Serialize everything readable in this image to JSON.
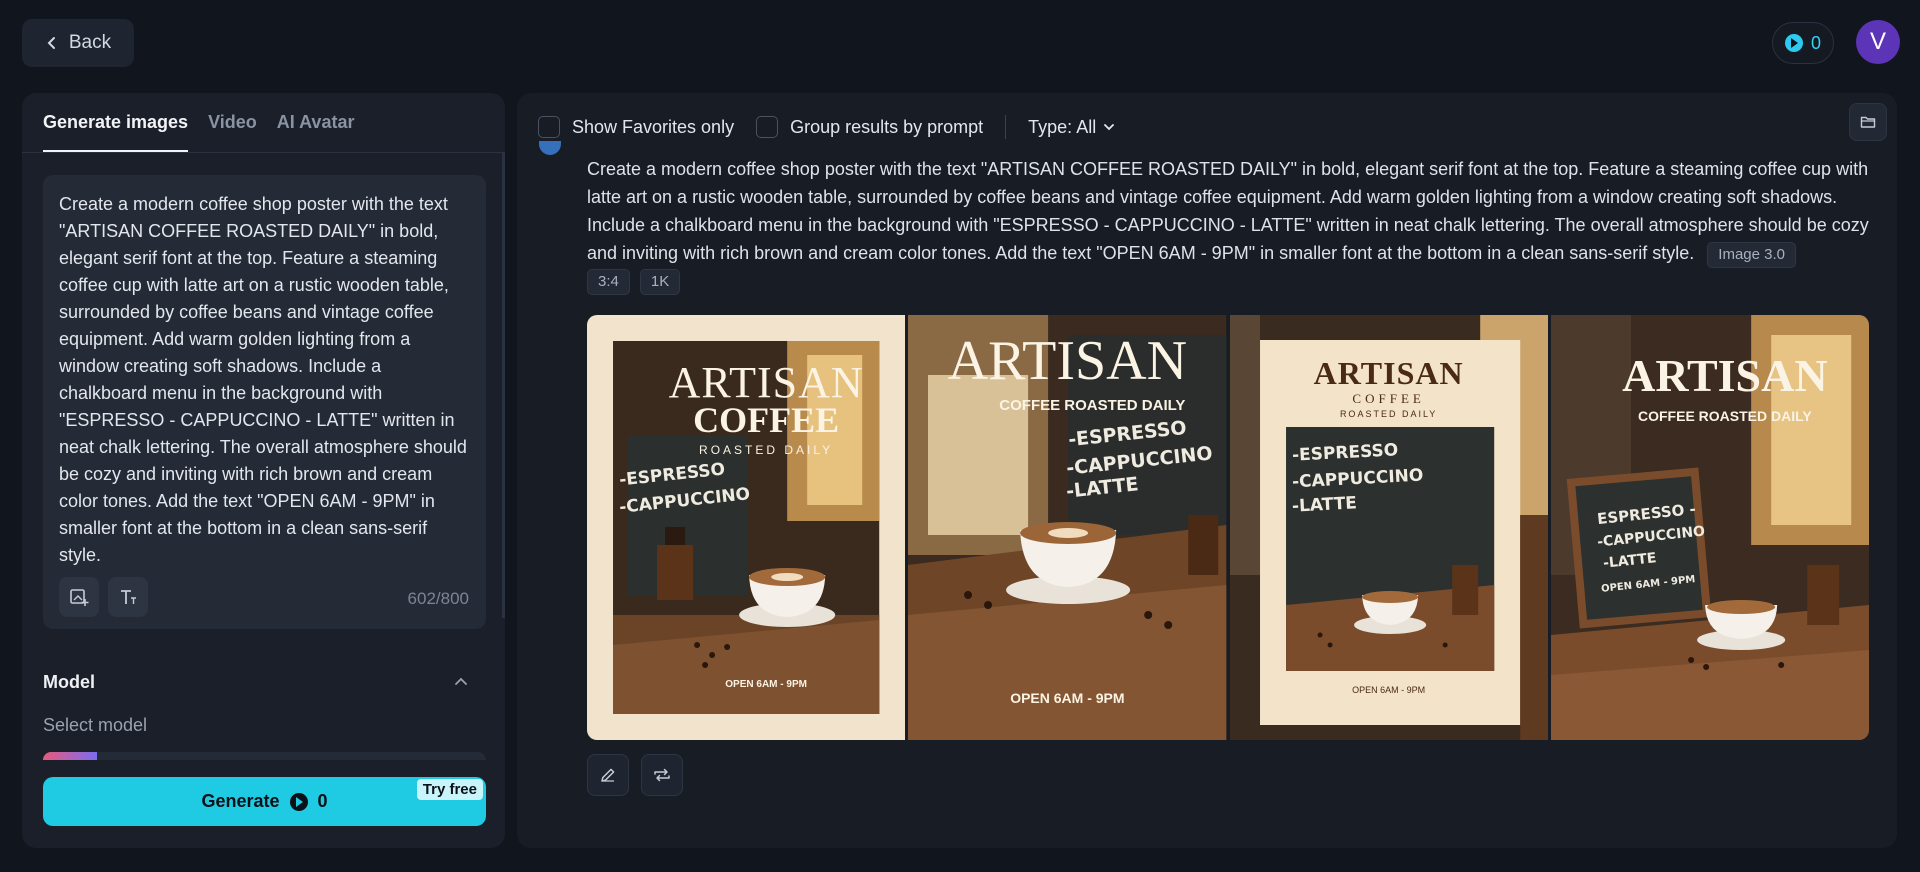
{
  "header": {
    "back_label": "Back",
    "credits": "0",
    "avatar_initial": "V"
  },
  "left_panel": {
    "tabs": [
      {
        "label": "Generate images",
        "active": true
      },
      {
        "label": "Video",
        "active": false
      },
      {
        "label": "AI Avatar",
        "active": false
      }
    ],
    "prompt": "Create a modern coffee shop poster with the text \"ARTISAN COFFEE ROASTED DAILY\" in bold, elegant serif font at the top. Feature a steaming coffee cup with latte art on a rustic wooden table, surrounded by coffee beans and vintage coffee equipment. Add warm golden lighting from a window creating soft shadows. Include a chalkboard menu in the background with \"ESPRESSO - CAPPUCCINO - LATTE\" written in neat chalk lettering. The overall atmosphere should be cozy and inviting with rich brown and cream color tones. Add the text \"OPEN 6AM - 9PM\" in smaller font at the bottom in a clean sans-serif style.",
    "char_count": "602/800",
    "model_title": "Model",
    "select_model_label": "Select model",
    "generate_label": "Generate",
    "generate_credits": "0",
    "try_free_label": "Try free"
  },
  "right_panel": {
    "show_favorites_label": "Show Favorites only",
    "group_results_label": "Group results by prompt",
    "type_filter_label": "Type: All",
    "result": {
      "prompt": "Create a modern coffee shop poster with the text \"ARTISAN COFFEE ROASTED DAILY\" in bold, elegant serif font at the top. Feature a steaming coffee cup with latte art on a rustic wooden table, surrounded by coffee beans and vintage coffee equipment. Add warm golden lighting from a window creating soft shadows. Include a chalkboard menu in the background with \"ESPRESSO - CAPPUCCINO - LATTE\" written in neat chalk lettering. The overall atmosphere should be cozy and inviting with rich brown and cream color tones. Add the text \"OPEN 6AM - 9PM\" in smaller font at the bottom in a clean sans-serif style.",
      "model_tag": "Image 3.0",
      "aspect_tag": "3:4",
      "resolution_tag": "1K"
    },
    "images": [
      {
        "title": "ARTISAN",
        "line2": "COFFEE",
        "line3": "ROASTED DAILY",
        "chalk1": "-ESPRESSO",
        "chalk2": "-CAPPUCCINO",
        "footer": "OPEN 6AM - 9PM"
      },
      {
        "title": "ARTISAN",
        "line2": "COFFEE ROASTED DAILY",
        "chalk1": "-ESPRESSO",
        "chalk2": "-CAPPUCCINO",
        "chalk3": "-LATTE",
        "footer": "OPEN 6AM - 9PM"
      },
      {
        "title": "ARTISAN",
        "line2": "COFFEE",
        "line3": "ROASTED DAILY",
        "chalk1": "-ESPRESSO",
        "chalk2": "-CAPPUCCINO",
        "chalk3": "-LATTE",
        "footer": "OPEN 6AM - 9PM"
      },
      {
        "title": "ARTISAN",
        "line2": "COFFEE ROASTED DAILY",
        "chalk1": "ESPRESSO -",
        "chalk2": "-CAPPUCCINO",
        "chalk3": "-LATTE",
        "chalk4": "OPEN 6AM - 9PM"
      }
    ]
  },
  "colors": {
    "accent": "#1fcbe3",
    "background": "#11151d",
    "panel": "#1a1f29",
    "avatar": "#5b34b8"
  }
}
